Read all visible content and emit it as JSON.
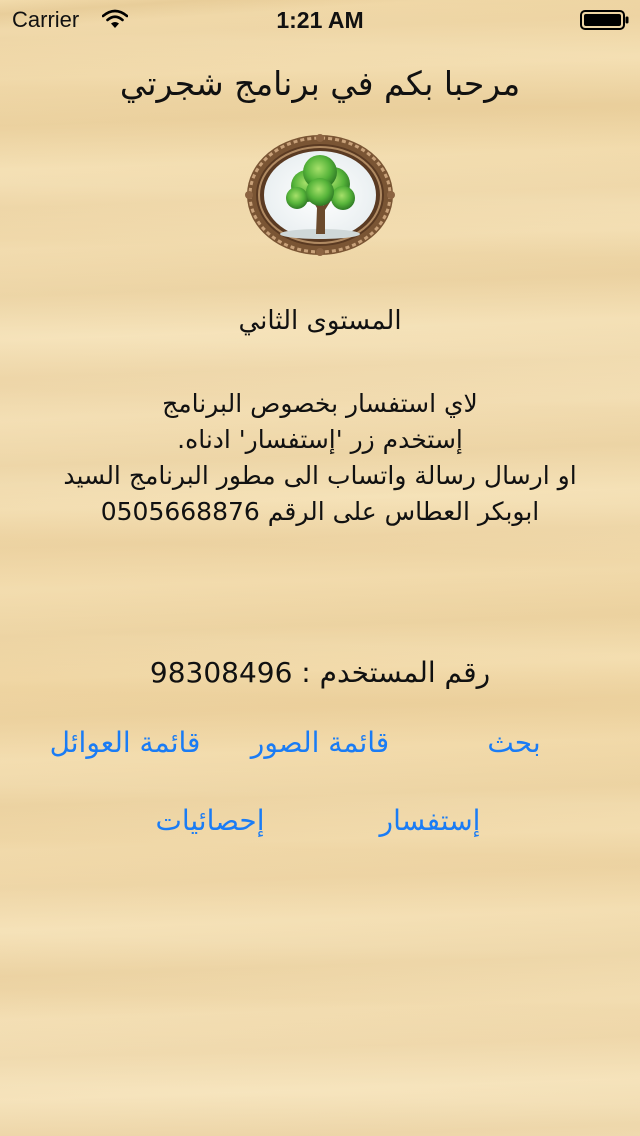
{
  "status_bar": {
    "carrier": "Carrier",
    "time": "1:21 AM"
  },
  "header": {
    "title": "مرحبا بكم في برنامج شجرتي"
  },
  "logo": {
    "icon": "tree-icon"
  },
  "level": "المستوى الثاني",
  "info": {
    "line1": "لاي استفسار بخصوص البرنامج",
    "line2": "إستخدم زر 'إستفسار' ادناه.",
    "line3": "او ارسال رسالة واتساب الى مطور البرنامج السيد",
    "line4": "ابوبكر العطاس على الرقم 0505668876"
  },
  "user": {
    "label": "رقم المستخدم : 98308496"
  },
  "buttons": {
    "search": "بحث",
    "photos": "قائمة الصور",
    "families": "قائمة العوائل",
    "inquiry": "إستفسار",
    "stats": "إحصائيات"
  },
  "colors": {
    "link": "#1a7cf5",
    "background": "#f2dcb0"
  }
}
